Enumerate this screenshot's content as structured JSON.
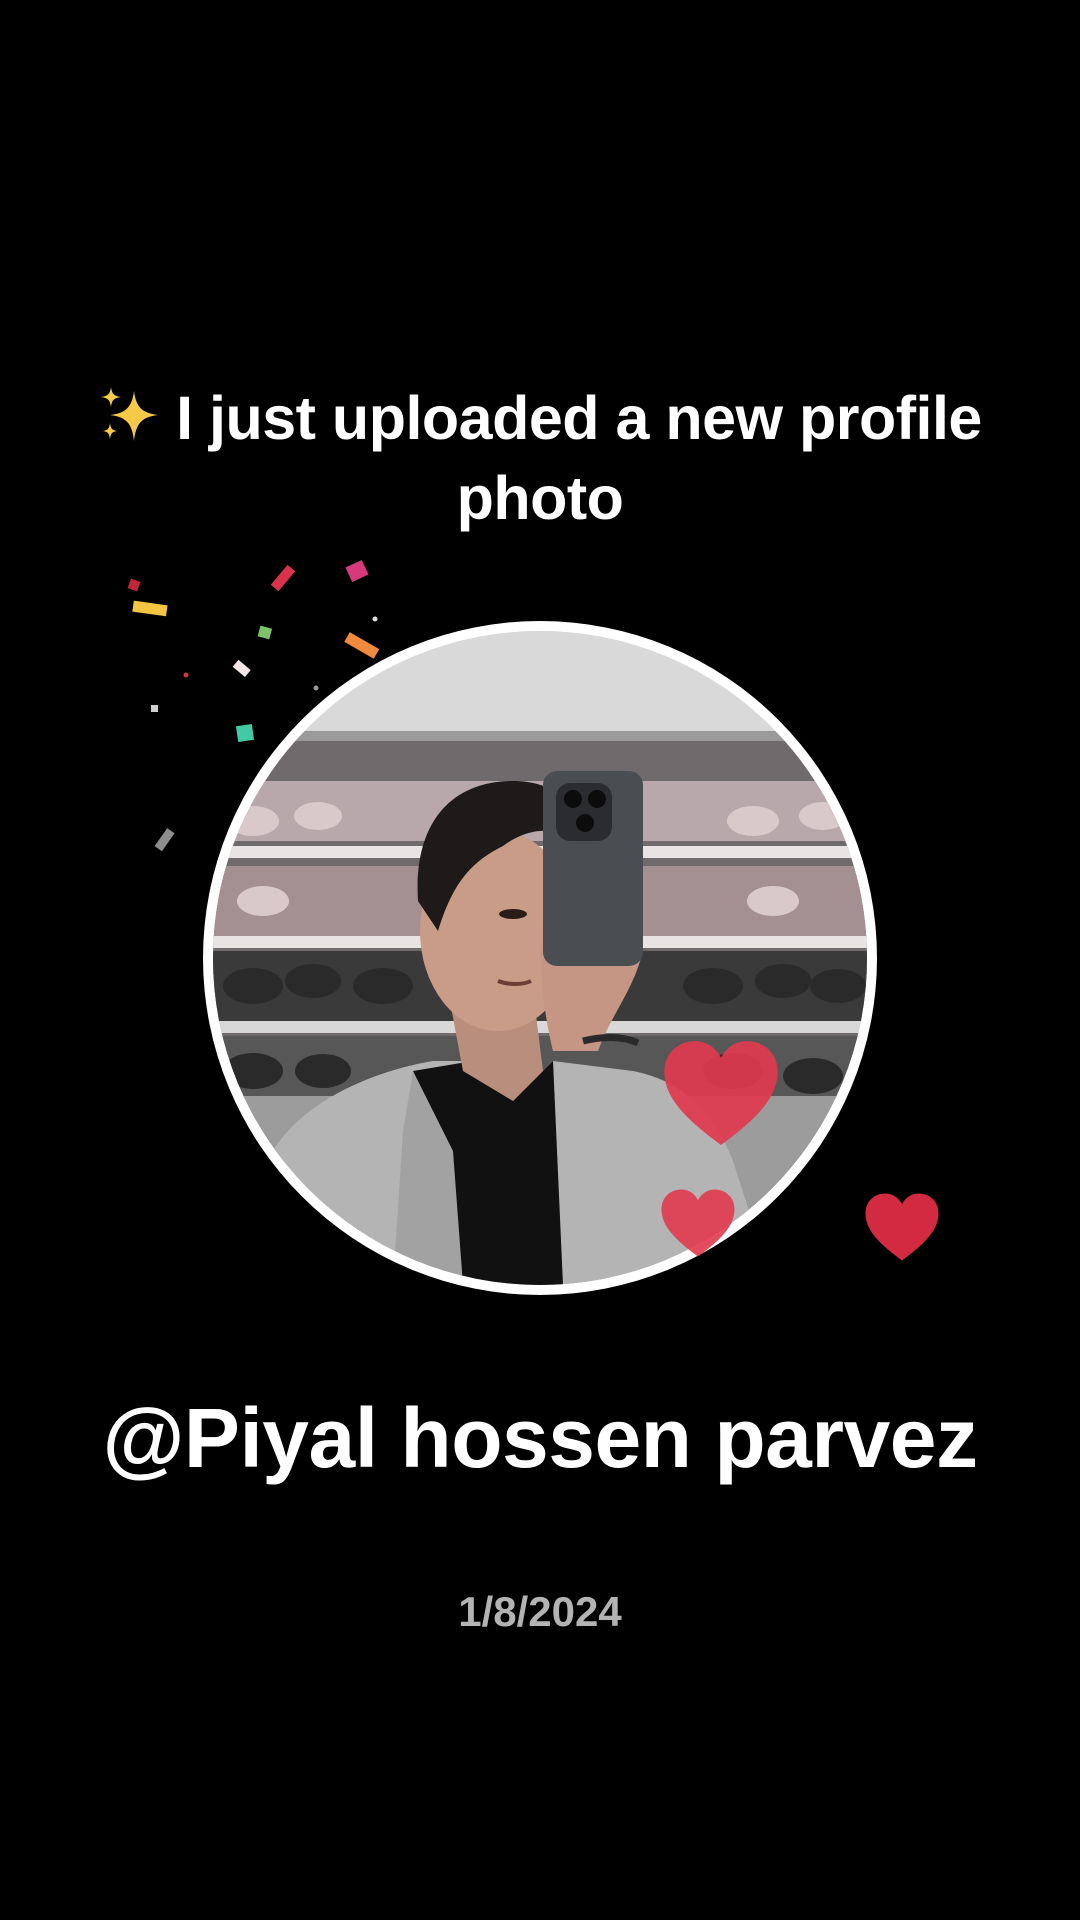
{
  "announcement": {
    "icon": "sparkles-icon",
    "text": "I just uploaded a new profile photo"
  },
  "profile": {
    "username": "@Piyal hossen parvez",
    "date": "1/8/2024"
  },
  "colors": {
    "background": "#000000",
    "text": "#ffffff",
    "date_text": "#b3b3b3",
    "ring": "#ffffff",
    "heart": "#d8283c",
    "sparkle": "#f7c948"
  }
}
